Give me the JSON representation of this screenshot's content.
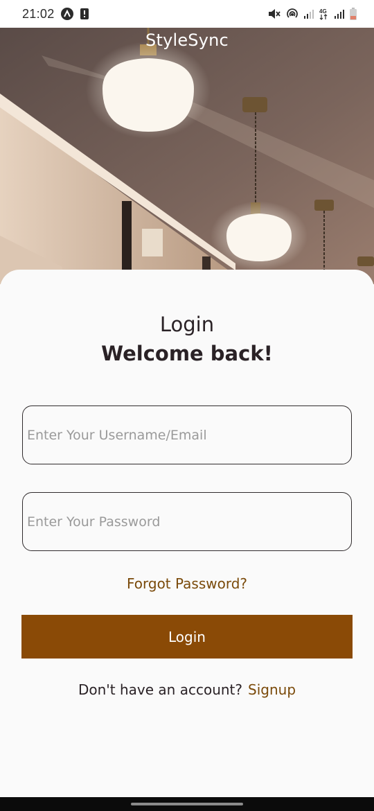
{
  "status_bar": {
    "time": "21:02",
    "network_label": "4G",
    "icons": [
      "app-logo-icon",
      "alert-icon",
      "mute-icon",
      "hotspot-icon",
      "signal-icon",
      "network-4g-icon",
      "signal-icon",
      "battery-icon"
    ]
  },
  "app": {
    "title": "StyleSync"
  },
  "login": {
    "title": "Login",
    "subtitle": "Welcome back!",
    "username_placeholder": "Enter Your Username/Email",
    "password_placeholder": "Enter Your Password",
    "forgot_label": "Forgot Password?",
    "button_label": "Login",
    "signup_prompt": "Don't have an account?",
    "signup_label": "Signup"
  },
  "colors": {
    "accent": "#8a4a06",
    "link": "#7a4a0a",
    "text": "#2a2226",
    "background": "#fafafa"
  }
}
